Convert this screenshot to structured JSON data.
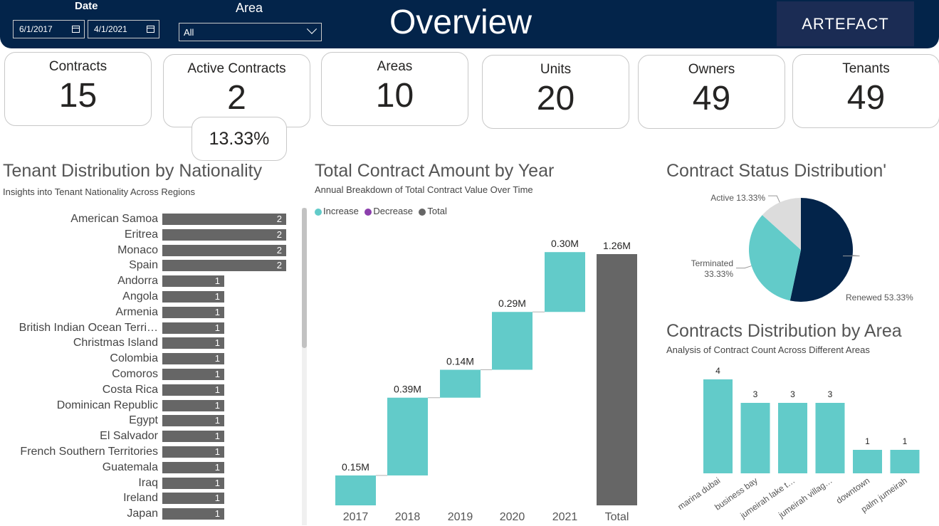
{
  "header": {
    "date_label": "Date",
    "date_start": "6/1/2017",
    "date_end": "4/1/2021",
    "area_label": "Area",
    "area_value": "All",
    "title": "Overview",
    "logo_text": "ARTEFACT",
    "bg_color": "#03244a"
  },
  "kpis": [
    {
      "label": "Contracts",
      "value": "15"
    },
    {
      "label": "Active Contracts",
      "value": "2"
    },
    {
      "label": "Areas",
      "value": "10"
    },
    {
      "label": "Units",
      "value": "20"
    },
    {
      "label": "Owners",
      "value": "49"
    },
    {
      "label": "Tenants",
      "value": "49"
    }
  ],
  "active_pct": "13.33%",
  "nationality": {
    "title": "Tenant Distribution by Nationality",
    "subtitle": "Insights into Tenant Nationality Across Regions"
  },
  "waterfall": {
    "title": "Total Contract Amount by Year",
    "subtitle": "Annual Breakdown of Total Contract Value Over Time",
    "legend": [
      {
        "label": "Increase",
        "color": "#62cbc9"
      },
      {
        "label": "Decrease",
        "color": "#8c3fad"
      },
      {
        "label": "Total",
        "color": "#666666"
      }
    ]
  },
  "status": {
    "title": "Contract Status Distribution'"
  },
  "area_chart": {
    "title": "Contracts Distribution by Area",
    "subtitle": "Analysis of Contract Count Across Different Areas"
  },
  "chart_data": [
    {
      "type": "bar",
      "orientation": "horizontal",
      "categories": [
        "American Samoa",
        "Eritrea",
        "Monaco",
        "Spain",
        "Andorra",
        "Angola",
        "Armenia",
        "British Indian Ocean Terri…",
        "Christmas Island",
        "Colombia",
        "Comoros",
        "Costa Rica",
        "Dominican Republic",
        "Egypt",
        "El Salvador",
        "French Southern Territories",
        "Guatemala",
        "Iraq",
        "Ireland",
        "Japan"
      ],
      "values": [
        2,
        2,
        2,
        2,
        1,
        1,
        1,
        1,
        1,
        1,
        1,
        1,
        1,
        1,
        1,
        1,
        1,
        1,
        1,
        1
      ],
      "color": "#666666"
    },
    {
      "type": "bar",
      "subtype": "waterfall",
      "categories": [
        "2017",
        "2018",
        "2019",
        "2020",
        "2021",
        "Total"
      ],
      "values": [
        0.15,
        0.39,
        0.14,
        0.29,
        0.3,
        1.26
      ],
      "data_labels": [
        "0.15M",
        "0.39M",
        "0.14M",
        "0.29M",
        "0.30M",
        "1.26M"
      ],
      "increase_color": "#62cbc9",
      "total_color": "#666666"
    },
    {
      "type": "pie",
      "slices": [
        {
          "label": "Renewed",
          "value": 53.33,
          "display": "Renewed 53.33%",
          "color": "#03244a"
        },
        {
          "label": "Terminated",
          "value": 33.33,
          "display": "Terminated 33.33%",
          "color": "#62cbc9"
        },
        {
          "label": "Active",
          "value": 13.33,
          "display": "Active 13.33%",
          "color": "#dcdcdc"
        }
      ]
    },
    {
      "type": "bar",
      "categories": [
        "marina dubai",
        "business bay",
        "jumeirah lake t…",
        "jumeirah villag…",
        "downtown",
        "palm jumeirah"
      ],
      "values": [
        4,
        3,
        3,
        3,
        1,
        1
      ],
      "ylim": [
        0,
        4
      ],
      "color": "#62cbc9"
    }
  ]
}
